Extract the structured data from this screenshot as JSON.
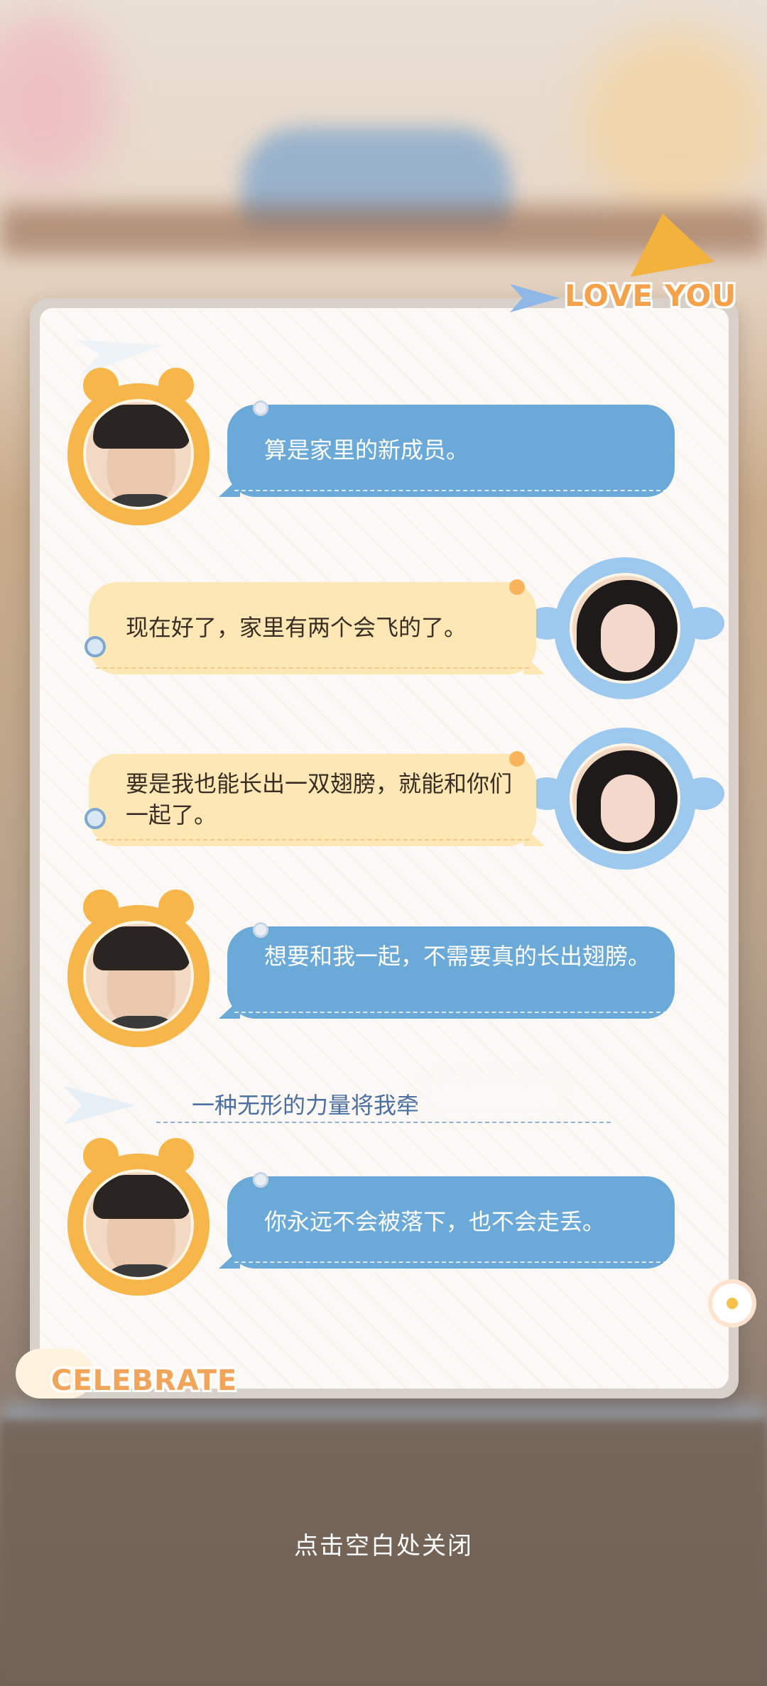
{
  "decor": {
    "top_tag": "LOVE YOU",
    "bottom_tag": "CELEBRATE"
  },
  "messages": [
    {
      "speaker": "male",
      "text": "算是家里的新成员。"
    },
    {
      "speaker": "female",
      "text": "现在好了，家里有两个会飞的了。"
    },
    {
      "speaker": "female",
      "text": "要是我也能长出一双翅膀，就能和你们一起了。"
    },
    {
      "speaker": "male",
      "text": "想要和我一起，不需要真的长出翅膀。"
    },
    {
      "speaker": "narration",
      "text": "一种无形的力量将我牵"
    },
    {
      "speaker": "male",
      "text": "你永远不会被落下，也不会走丢。"
    }
  ],
  "footer": {
    "close_hint": "点击空白处关闭"
  },
  "colors": {
    "blue_bubble": "#6aa9d8",
    "yellow_bubble": "#fde7b4",
    "accent_orange": "#f6b649"
  }
}
